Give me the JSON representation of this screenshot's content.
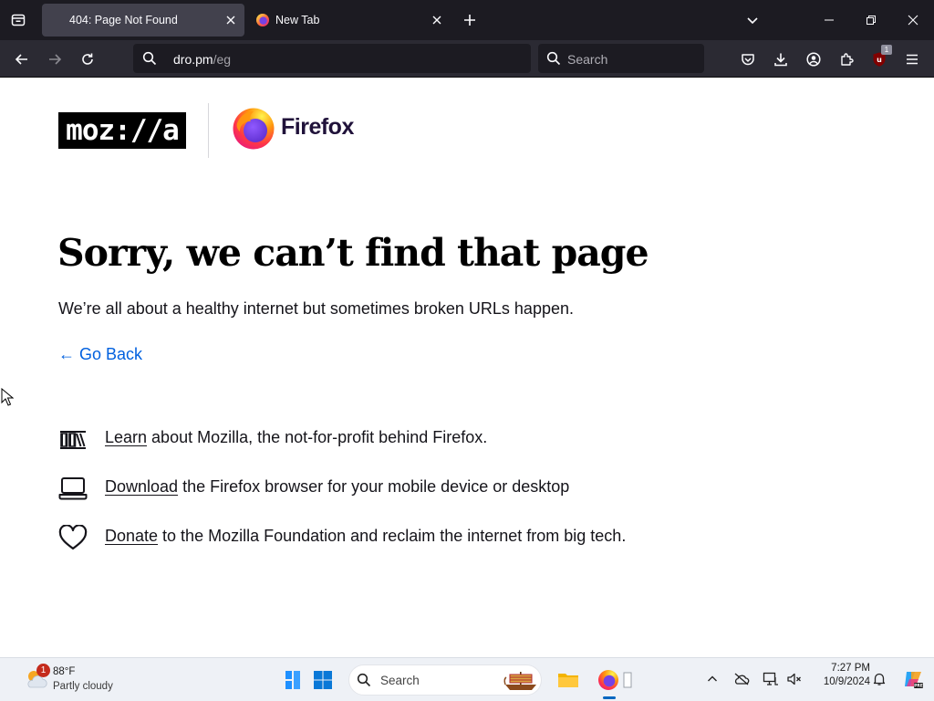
{
  "browser": {
    "tabs": [
      {
        "title": "404: Page Not Found",
        "active": true
      },
      {
        "title": "New Tab",
        "active": false
      }
    ],
    "url": {
      "host": "dro.pm",
      "path": "/eg"
    },
    "search_placeholder": "Search",
    "extension_badge": "1"
  },
  "page": {
    "logo_text": "moz://a",
    "product_name": "Firefox",
    "heading": "Sorry, we can’t find that page",
    "subtext": "We’re all about a healthy internet but sometimes broken URLs happen.",
    "go_back": "← Go Back",
    "links": [
      {
        "icon": "books-icon",
        "link": "Learn",
        "text": " about Mozilla, the not-for-profit behind Firefox."
      },
      {
        "icon": "laptop-icon",
        "link": "Download",
        "text": " the Firefox browser for your mobile device or desktop"
      },
      {
        "icon": "heart-icon",
        "link": "Donate",
        "text": " to the Mozilla Foundation and reclaim the internet from big tech."
      }
    ]
  },
  "taskbar": {
    "weather_temp": "88°F",
    "weather_condition": "Partly cloudy",
    "weather_badge": "1",
    "search_label": "Search",
    "time": "7:27 PM",
    "date": "10/9/2024"
  },
  "colors": {
    "tabbar_bg": "#1c1b22",
    "navbar_bg": "#2b2a33",
    "link_blue": "#0060df",
    "heading_black": "#000000"
  }
}
